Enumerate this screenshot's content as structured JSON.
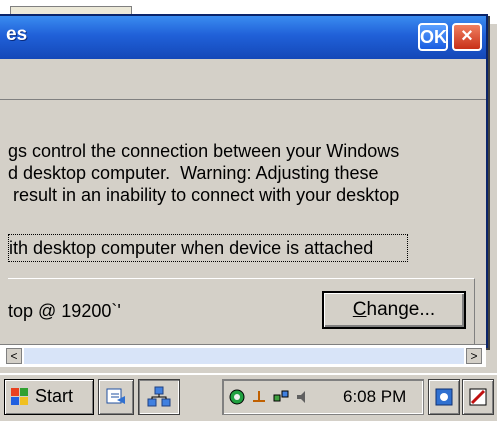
{
  "window": {
    "title": "es",
    "ok_label": "OK",
    "close_label": "×"
  },
  "body": {
    "line1": "gs control the connection between your Windows",
    "line2": "d desktop computer.  Warning: Adjusting these",
    "line3": " result in an inability to connect with your desktop"
  },
  "checkbox": {
    "label": "ith desktop computer when device is attached"
  },
  "connection": {
    "label": "top @ 19200`'",
    "change_label_prefix": "C",
    "change_label_rest": "hange..."
  },
  "scrollbar": {
    "left_arrow": "<",
    "right_arrow": ">"
  },
  "taskbar": {
    "start_label": "Start",
    "clock": "6:08 PM"
  },
  "colors": {
    "title_bar": "#2060d8",
    "dialog_bg": "#d4d0c8",
    "close_red": "#c83018"
  }
}
